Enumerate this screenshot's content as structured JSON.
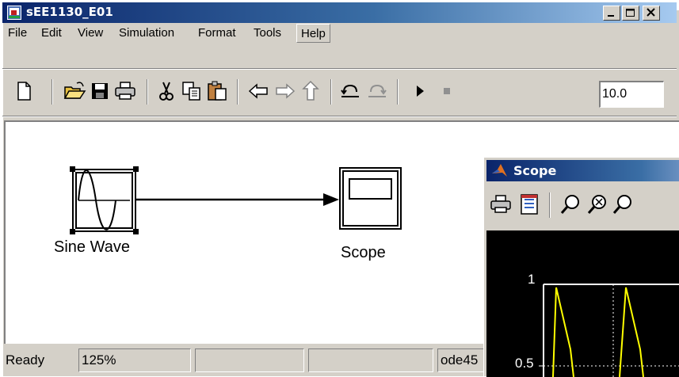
{
  "window": {
    "title": "sEE1130_E01"
  },
  "menu": [
    "File",
    "Edit",
    "View",
    "Simulation",
    "Format",
    "Tools",
    "Help"
  ],
  "toolbar": {
    "stop_time": "10.0"
  },
  "blocks": {
    "sine_label": "Sine Wave",
    "scope_label": "Scope"
  },
  "status": {
    "state": "Ready",
    "zoom": "125%",
    "cell3": "",
    "cell4": "",
    "solver": "ode45"
  },
  "scope": {
    "title": "Scope",
    "y_ticks": [
      "1",
      "0.5"
    ]
  },
  "colors": {
    "title_start": "#0a246a",
    "title_end": "#a6caf0",
    "chrome": "#d4d0c8",
    "plot_bg": "#000000",
    "trace": "#ffff00"
  }
}
